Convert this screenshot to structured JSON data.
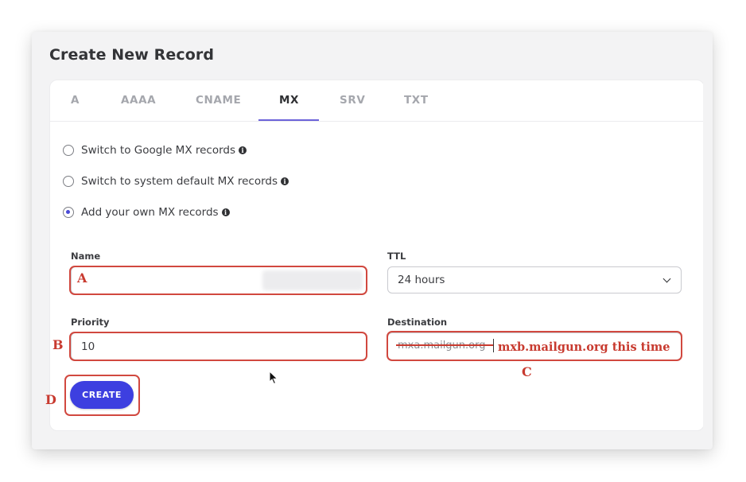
{
  "dialog": {
    "title": "Create New Record"
  },
  "tabs": [
    {
      "label": "A",
      "active": false
    },
    {
      "label": "AAAA",
      "active": false
    },
    {
      "label": "CNAME",
      "active": false
    },
    {
      "label": "MX",
      "active": true
    },
    {
      "label": "SRV",
      "active": false
    },
    {
      "label": "TXT",
      "active": false
    }
  ],
  "mx_options": [
    {
      "label": "Switch to Google MX records",
      "checked": false
    },
    {
      "label": "Switch to system default MX records",
      "checked": false
    },
    {
      "label": "Add your own MX records",
      "checked": true
    }
  ],
  "form": {
    "name": {
      "label": "Name",
      "value": ""
    },
    "ttl": {
      "label": "TTL",
      "value": "24 hours"
    },
    "priority": {
      "label": "Priority",
      "value": "10"
    },
    "destination": {
      "label": "Destination",
      "value": "mxa.mailgun.org"
    },
    "create_label": "CREATE"
  },
  "annotations": {
    "a": "A",
    "b": "B",
    "c": "C",
    "d": "D",
    "destination_note": "mxb.mailgun.org this time"
  },
  "colors": {
    "accent": "#3d3fe0",
    "tab_underline": "#6c63d9",
    "annotation": "#c83a2f"
  }
}
